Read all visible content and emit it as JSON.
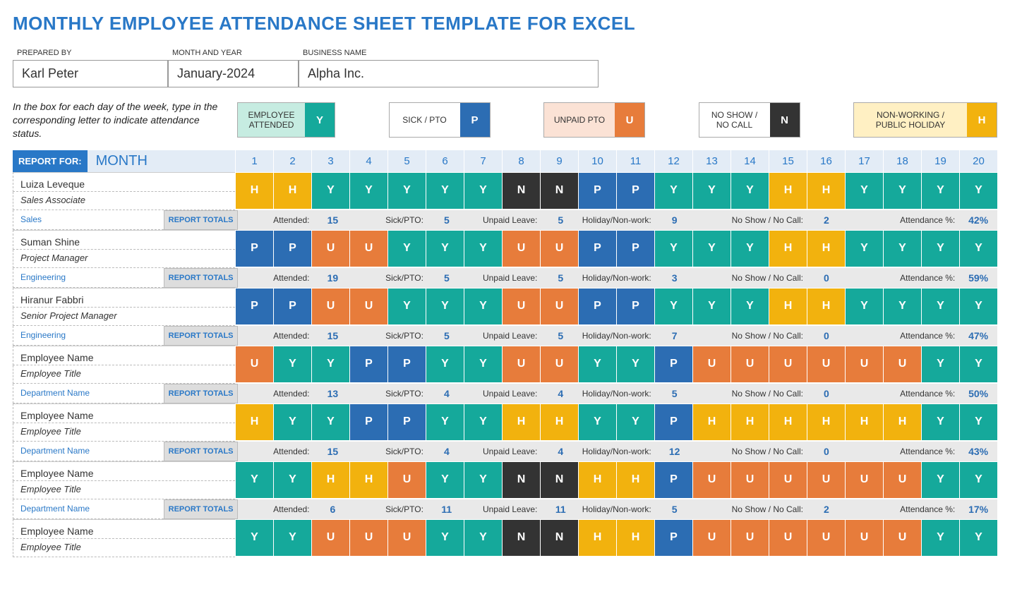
{
  "title": "MONTHLY EMPLOYEE ATTENDANCE SHEET TEMPLATE FOR EXCEL",
  "meta": {
    "prepared_by_label": "PREPARED BY",
    "prepared_by": "Karl Peter",
    "month_year_label": "MONTH AND YEAR",
    "month_year": "January-2024",
    "business_label": "BUSINESS NAME",
    "business": "Alpha Inc."
  },
  "instructions": "In the box for each day of the week, type in the corresponding letter to indicate attendance status.",
  "legend": [
    {
      "label": "EMPLOYEE ATTENDED",
      "code": "Y"
    },
    {
      "label": "SICK / PTO",
      "code": "P"
    },
    {
      "label": "UNPAID PTO",
      "code": "U"
    },
    {
      "label": "NO SHOW / NO CALL",
      "code": "N"
    },
    {
      "label": "NON-WORKING / PUBLIC HOLIDAY",
      "code": "H"
    }
  ],
  "report_for_label": "REPORT FOR:",
  "report_for_value": "MONTH",
  "days": [
    "1",
    "2",
    "3",
    "4",
    "5",
    "6",
    "7",
    "8",
    "9",
    "10",
    "11",
    "12",
    "13",
    "14",
    "15",
    "16",
    "17",
    "18",
    "19",
    "20"
  ],
  "totals_badge": "REPORT TOTALS",
  "totals_labels": {
    "attended": "Attended:",
    "sick": "Sick/PTO:",
    "unpaid": "Unpaid Leave:",
    "holiday": "Holiday/Non-work:",
    "noshow": "No Show / No Call:",
    "pct": "Attendance %:"
  },
  "employees": [
    {
      "name": "Luiza Leveque",
      "title": "Sales Associate",
      "dept": "Sales",
      "days": [
        "H",
        "H",
        "Y",
        "Y",
        "Y",
        "Y",
        "Y",
        "N",
        "N",
        "P",
        "P",
        "Y",
        "Y",
        "Y",
        "H",
        "H",
        "Y",
        "Y",
        "Y",
        "Y"
      ],
      "totals": {
        "attended": "15",
        "sick": "5",
        "unpaid": "5",
        "holiday": "9",
        "noshow": "2",
        "pct": "42%"
      }
    },
    {
      "name": "Suman Shine",
      "title": "Project Manager",
      "dept": "Engineering",
      "days": [
        "P",
        "P",
        "U",
        "U",
        "Y",
        "Y",
        "Y",
        "U",
        "U",
        "P",
        "P",
        "Y",
        "Y",
        "Y",
        "H",
        "H",
        "Y",
        "Y",
        "Y",
        "Y"
      ],
      "totals": {
        "attended": "19",
        "sick": "5",
        "unpaid": "5",
        "holiday": "3",
        "noshow": "0",
        "pct": "59%"
      }
    },
    {
      "name": "Hiranur Fabbri",
      "title": "Senior Project Manager",
      "dept": "Engineering",
      "days": [
        "P",
        "P",
        "U",
        "U",
        "Y",
        "Y",
        "Y",
        "U",
        "U",
        "P",
        "P",
        "Y",
        "Y",
        "Y",
        "H",
        "H",
        "Y",
        "Y",
        "Y",
        "Y"
      ],
      "totals": {
        "attended": "15",
        "sick": "5",
        "unpaid": "5",
        "holiday": "7",
        "noshow": "0",
        "pct": "47%"
      }
    },
    {
      "name": "Employee Name",
      "title": "Employee Title",
      "dept": "Department Name",
      "days": [
        "U",
        "Y",
        "Y",
        "P",
        "P",
        "Y",
        "Y",
        "U",
        "U",
        "Y",
        "Y",
        "P",
        "U",
        "U",
        "U",
        "U",
        "U",
        "U",
        "Y",
        "Y"
      ],
      "totals": {
        "attended": "13",
        "sick": "4",
        "unpaid": "4",
        "holiday": "5",
        "noshow": "0",
        "pct": "50%"
      }
    },
    {
      "name": "Employee Name",
      "title": "Employee Title",
      "dept": "Department Name",
      "days": [
        "H",
        "Y",
        "Y",
        "P",
        "P",
        "Y",
        "Y",
        "H",
        "H",
        "Y",
        "Y",
        "P",
        "H",
        "H",
        "H",
        "H",
        "H",
        "H",
        "Y",
        "Y"
      ],
      "totals": {
        "attended": "15",
        "sick": "4",
        "unpaid": "4",
        "holiday": "12",
        "noshow": "0",
        "pct": "43%"
      }
    },
    {
      "name": "Employee Name",
      "title": "Employee Title",
      "dept": "Department Name",
      "days": [
        "Y",
        "Y",
        "H",
        "H",
        "U",
        "Y",
        "Y",
        "N",
        "N",
        "H",
        "H",
        "P",
        "U",
        "U",
        "U",
        "U",
        "U",
        "U",
        "Y",
        "Y"
      ],
      "totals": {
        "attended": "6",
        "sick": "11",
        "unpaid": "11",
        "holiday": "5",
        "noshow": "2",
        "pct": "17%"
      }
    },
    {
      "name": "Employee Name",
      "title": "Employee Title",
      "dept": "",
      "days": [
        "Y",
        "Y",
        "U",
        "U",
        "U",
        "Y",
        "Y",
        "N",
        "N",
        "H",
        "H",
        "P",
        "U",
        "U",
        "U",
        "U",
        "U",
        "U",
        "Y",
        "Y"
      ],
      "totals": null
    }
  ]
}
